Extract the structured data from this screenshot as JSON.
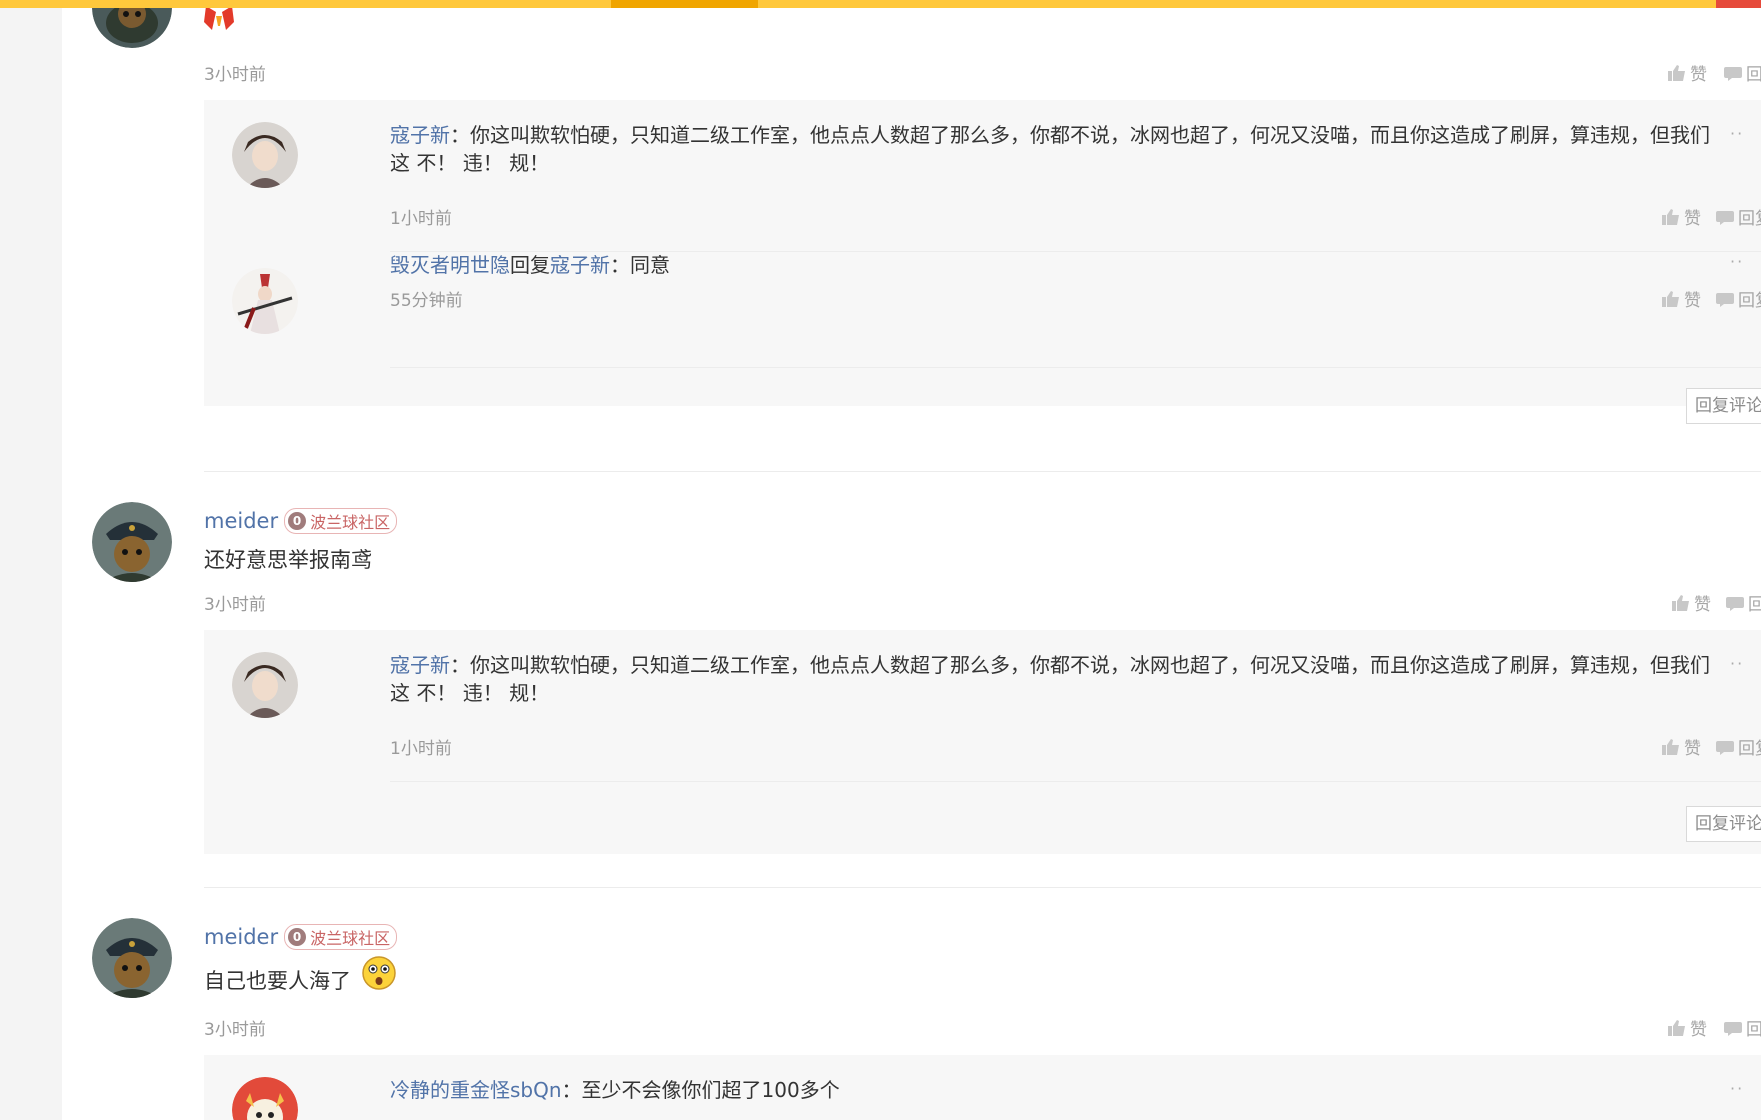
{
  "colors": {
    "accent_bar": "#ffc83c",
    "accent_bar_active": "#f0a500",
    "link": "#5173a8",
    "badge": "#c96565"
  },
  "actions": {
    "like": "赞",
    "reply_short": "回",
    "reply_mid": "回复",
    "reply_comment": "回复评论"
  },
  "thread1": {
    "time": "3小时前",
    "replies": [
      {
        "user": "寇子新",
        "sep": "：",
        "text_line1": "你这叫欺软怕硬，只知道二级工作室，他点点人数超了那么多，你都不说，冰网也超了，何况又没喵，而且你这造成了刷屏，算违规，但我们",
        "text_line2": "这 不！ 违！ 规！",
        "time": "1小时前",
        "avatar": "anime-boy-avatar"
      },
      {
        "user": "毁灭者明世隐",
        "reply_word": "回复",
        "target": "寇子新",
        "sep": "：",
        "text_line1": "同意",
        "time": "55分钟前",
        "avatar": "warrior-avatar"
      }
    ]
  },
  "thread2": {
    "user": "meider",
    "badge_level": "0",
    "badge_text": "波兰球社区",
    "text": "还好意思举报南鸢",
    "time": "3小时前",
    "replies": [
      {
        "user": "寇子新",
        "sep": "：",
        "text_line1": "你这叫欺软怕硬，只知道二级工作室，他点点人数超了那么多，你都不说，冰网也超了，何况又没喵，而且你这造成了刷屏，算违规，但我们",
        "text_line2": "这 不！ 违！ 规！",
        "time": "1小时前"
      }
    ]
  },
  "thread3": {
    "user": "meider",
    "badge_level": "0",
    "badge_text": "波兰球社区",
    "text": "自己也要人海了",
    "emoji": "surprised-emoji",
    "time": "3小时前",
    "replies": [
      {
        "user": "冷静的重金怪sbQn",
        "sep": "：",
        "text_line1": "至少不会像你们超了100多个"
      }
    ]
  }
}
